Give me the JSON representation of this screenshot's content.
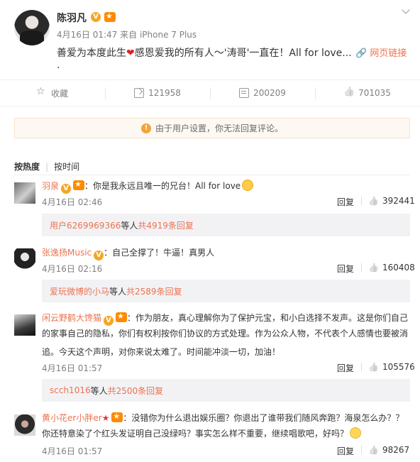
{
  "post": {
    "author": "陈羽凡",
    "time": "4月16日 01:47",
    "source": "来自 iPhone 7 Plus",
    "text_before": "善爱为本度此生",
    "text_after": "感恩爱我的所有人～'涛哥'一直在！All for love...",
    "heart": "❤",
    "dot": ".",
    "web_link": "网页链接",
    "v_badge": "V"
  },
  "actions": {
    "favorite": "收藏",
    "forward": "121958",
    "comment": "200209",
    "like": "701035"
  },
  "notice": {
    "icon": "!",
    "text": "由于用户设置，你无法回复评论。"
  },
  "sort": {
    "hot": "按热度",
    "time": "按时间"
  },
  "comments": [
    {
      "name": "羽泉",
      "text": "：你是我永远且唯一的兄台！All for love",
      "time": "4月16日 02:46",
      "reply": "回复",
      "likes": "392441",
      "sub_user": "用户6269969366",
      "sub_mid": " 等人 ",
      "sub_total": "共4919条回复"
    },
    {
      "name": "张逸扬Music",
      "text": "：自己全撑了！牛逼！真男人",
      "time": "4月16日 02:16",
      "reply": "回复",
      "likes": "160408",
      "sub_user": "爱玩微博的小马",
      "sub_mid": " 等人 ",
      "sub_total": "共2589条回复"
    },
    {
      "name": "闲云野鹤大馋猫",
      "text1": "：作为朋友，真心理解你为了保护元宝，和小白选择不发声。这是你们自己",
      "text2": "的家事自己的隐私，你们有权利按你们协议的方式处理。作为公众人物，不代表个人感情也要被消",
      "text3": "追。今天这个声明，对你来说太难了。时间能冲淡一切，加油！",
      "time": "4月16日 01:57",
      "reply": "回复",
      "likes": "105576",
      "sub_user": "scch1016",
      "sub_mid": " 等人 ",
      "sub_total": "共2500条回复"
    },
    {
      "name": "黄小花er小胖er",
      "star": "★",
      "text1": "：没错你为什么退出娱乐圈？你退出了谁带我们随风奔跑？海泉怎么办？？",
      "text2": "你还特意染了个红头发证明自己没绿吗？事实怎么样不重要，继续唱歌吧，好吗？",
      "time": "4月16日 01:57",
      "reply": "回复",
      "likes": "98267"
    }
  ]
}
